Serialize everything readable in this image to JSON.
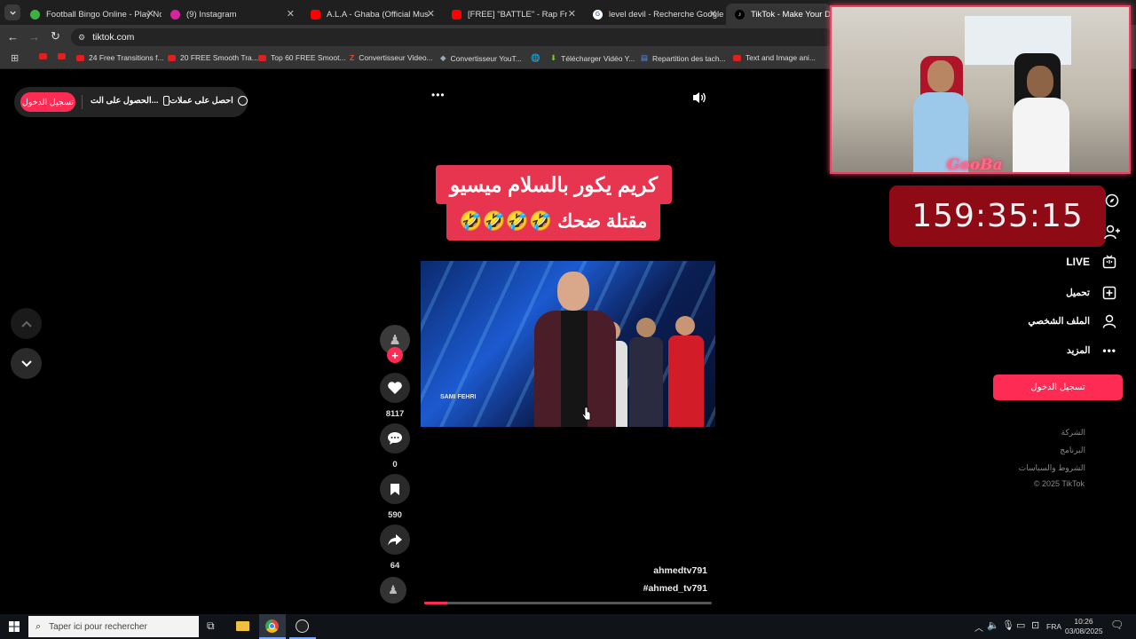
{
  "browser": {
    "tabs": [
      {
        "title": "Football Bingo Online - Play No",
        "icon_color": "#3cb043"
      },
      {
        "title": "(9) Instagram",
        "icon_color": "#d6249f"
      },
      {
        "title": "A.L.A - Ghaba (Official Music Vi",
        "icon_color": "#ff0000"
      },
      {
        "title": "[FREE] \"BATTLE\" - Rap Freestyle",
        "icon_color": "#ff0000"
      },
      {
        "title": "level devil - Recherche Google",
        "icon_color": "#ffffff"
      },
      {
        "title": "TikTok - Make Your Day",
        "icon_color": "#000000"
      }
    ],
    "url": "tiktok.com",
    "bookmarks": [
      "",
      "",
      "24 Free Transitions f...",
      "20 FREE Smooth Tra...",
      "Top 60 FREE Smoot...",
      "Convertisseur Video...",
      "Convertisseur YouT...",
      "",
      "Télécharger Vidéo Y...",
      "Repartition des tach...",
      "Text and Image ani..."
    ]
  },
  "topbar": {
    "login_label": "تسجيل الدخول",
    "get_app_label": "الحصول على الت...",
    "get_coins_label": "احصل على عملات",
    "more_label": "•••"
  },
  "video": {
    "caption_line1": "كريم يكور بالسلام ميسيو",
    "caption_line2": "مقتلة ضحك 🤣🤣🤣🤣",
    "watermark": "SAMI FEHRI",
    "author": "ahmedtv791",
    "hashtag": "#ahmed_tv791",
    "progress": 0.08
  },
  "actions": {
    "likes": "8117",
    "comments": "0",
    "saves": "590",
    "shares": "64"
  },
  "stream_overlay": {
    "channel_label": "GooBa",
    "timer": "159:35:15"
  },
  "sidebar": {
    "live_label": "LIVE",
    "upload_label": "تحميل",
    "profile_label": "الملف الشخصي",
    "more_label": "المزيد",
    "login_button": "تسجيل الدخول",
    "footer": [
      "الشركة",
      "البرنامج",
      "الشروط والسياسات",
      "© 2025 TikTok"
    ]
  },
  "taskbar": {
    "search_placeholder": "Taper ici pour rechercher",
    "language": "FRA",
    "time": "10:26",
    "date": "03/08/2025"
  },
  "colors": {
    "accent": "#fe2c55",
    "caption_bg": "#e8354f",
    "timer_bg": "#8e0a14"
  }
}
